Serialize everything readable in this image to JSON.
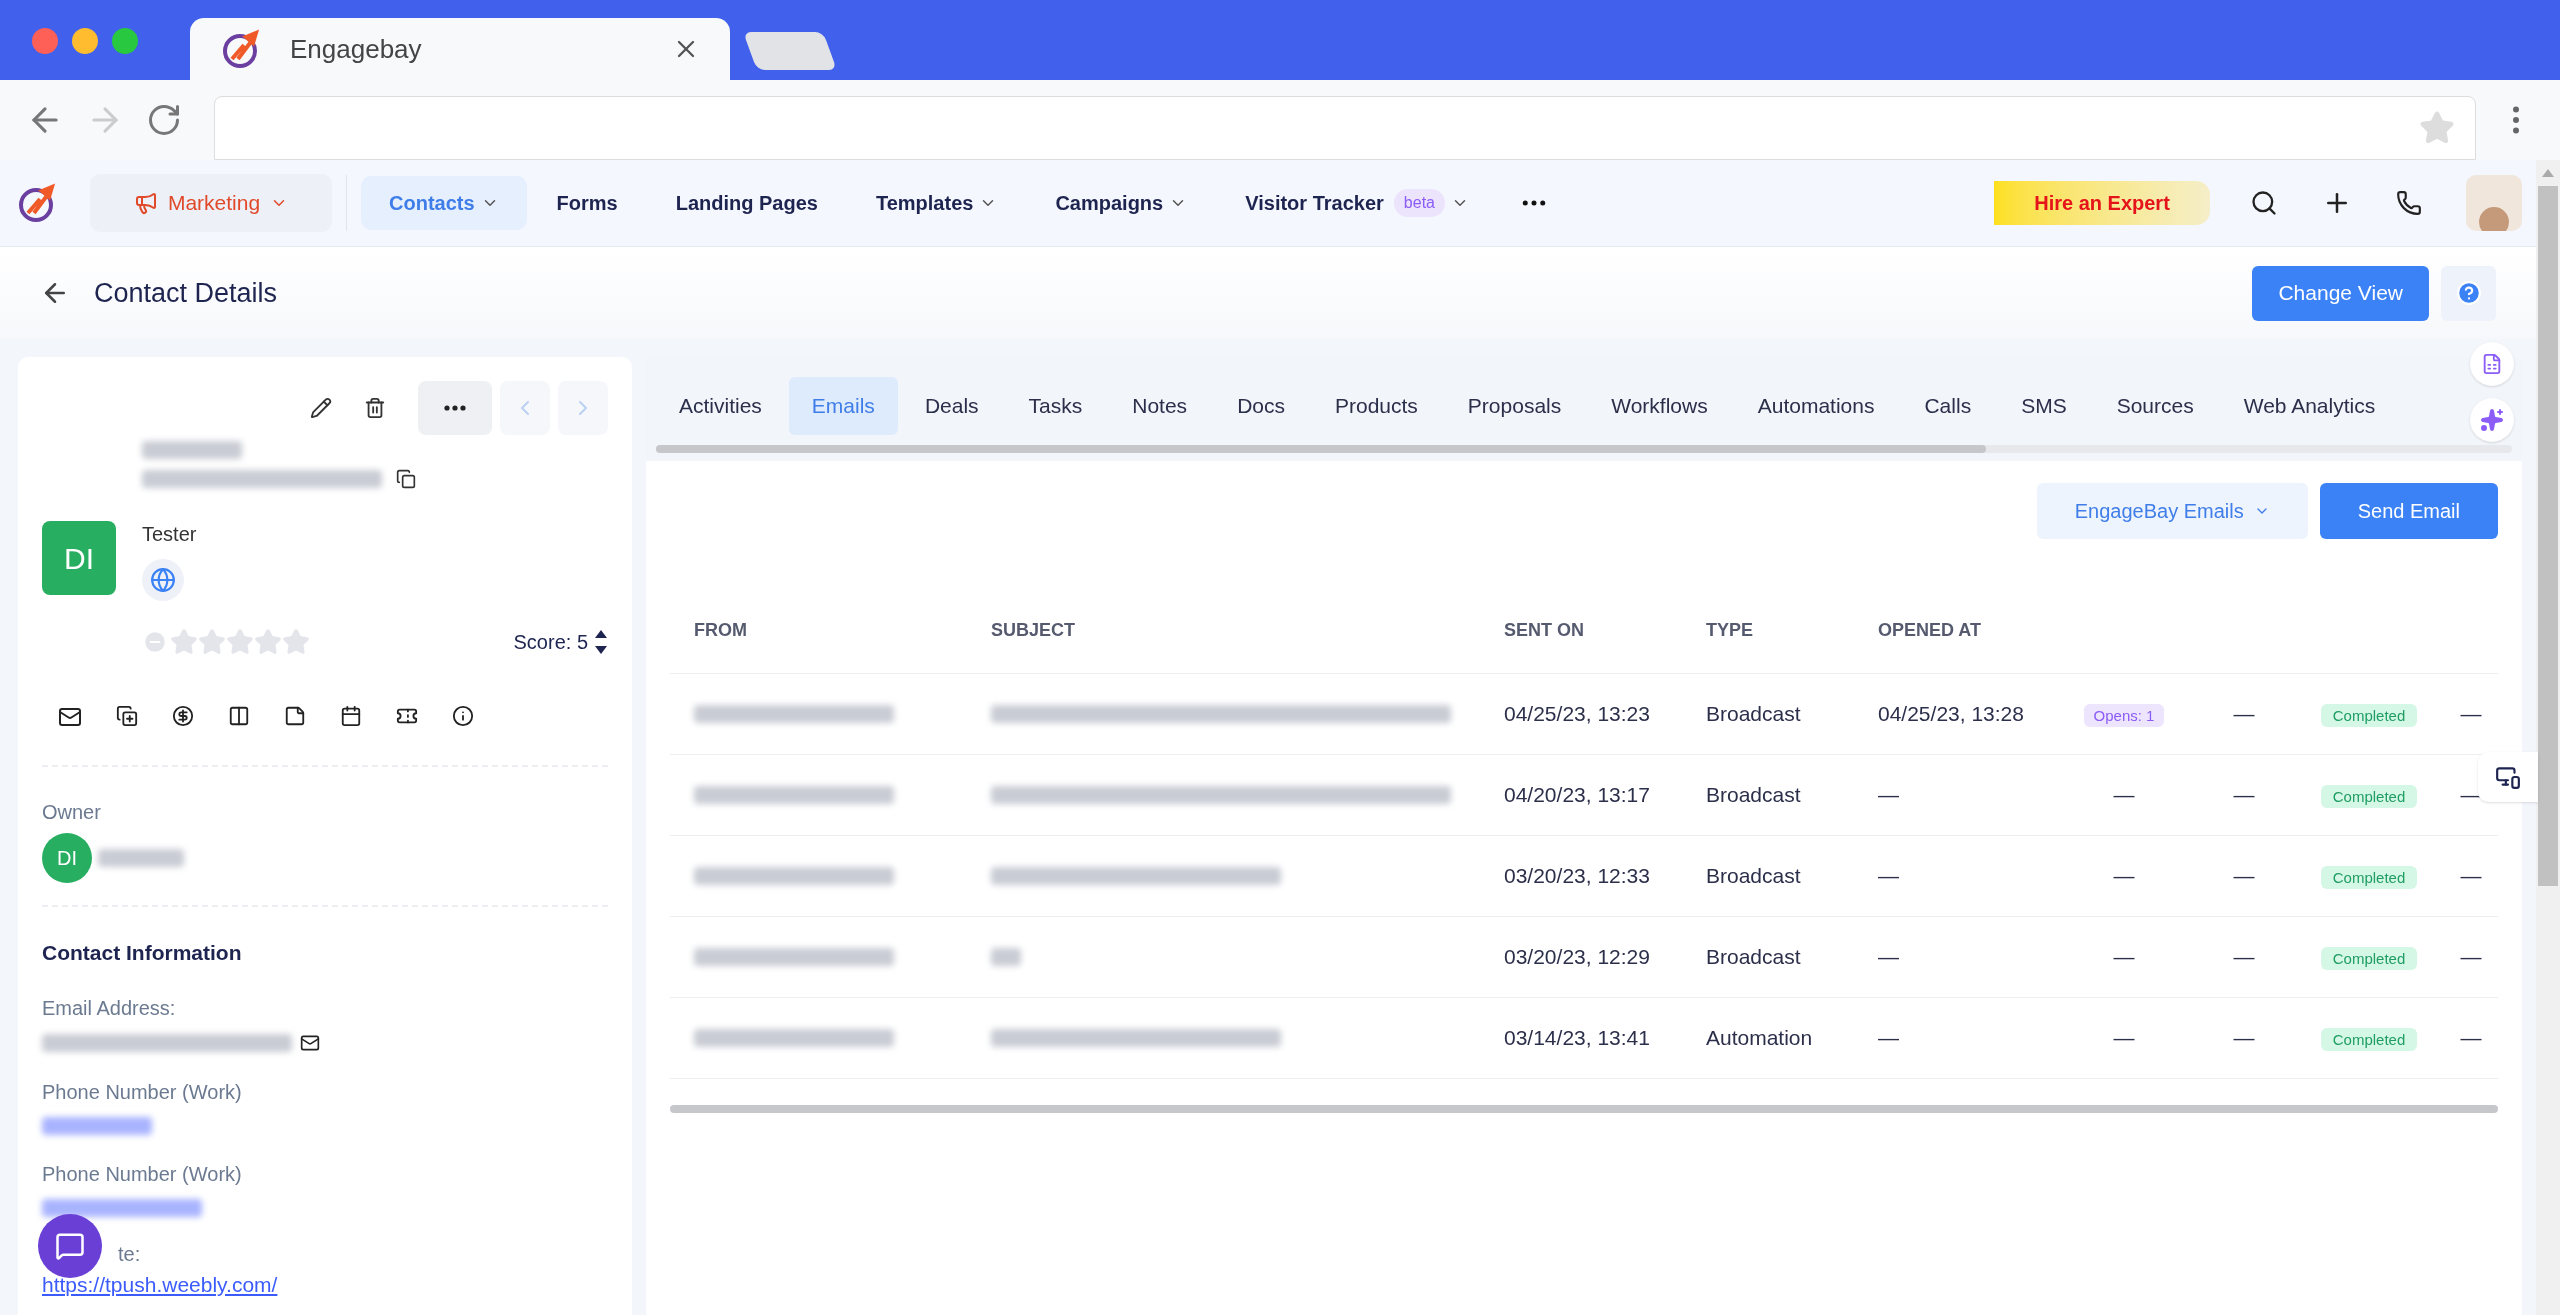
{
  "browser": {
    "tab_title": "Engagebay"
  },
  "nav": {
    "module": "Marketing",
    "items": [
      {
        "label": "Contacts",
        "selected": true,
        "dropdown": true
      },
      {
        "label": "Forms",
        "selected": false,
        "dropdown": false
      },
      {
        "label": "Landing Pages",
        "selected": false,
        "dropdown": false
      },
      {
        "label": "Templates",
        "selected": false,
        "dropdown": true
      },
      {
        "label": "Campaigns",
        "selected": false,
        "dropdown": true
      },
      {
        "label": "Visitor Tracker",
        "selected": false,
        "dropdown": true,
        "badge": "beta"
      }
    ],
    "hire": "Hire an Expert"
  },
  "header": {
    "title": "Contact Details",
    "button": "Change View"
  },
  "contact": {
    "initials": "DI",
    "role": "Tester",
    "stars": 0,
    "score": "Score: 5",
    "owner_label": "Owner",
    "owner_initials": "DI",
    "section_title": "Contact Information",
    "fields": [
      {
        "label": "Email Address:",
        "kind": "email"
      },
      {
        "label": "Phone Number (Work)",
        "kind": "phone"
      },
      {
        "label": "Phone Number (Work)",
        "kind": "phone"
      }
    ],
    "website": {
      "label": "te:",
      "value": "https://tpush.weebly.com/"
    }
  },
  "tabs": [
    {
      "label": "Activities",
      "selected": false
    },
    {
      "label": "Emails",
      "selected": true
    },
    {
      "label": "Deals",
      "selected": false
    },
    {
      "label": "Tasks",
      "selected": false
    },
    {
      "label": "Notes",
      "selected": false
    },
    {
      "label": "Docs",
      "selected": false
    },
    {
      "label": "Products",
      "selected": false
    },
    {
      "label": "Proposals",
      "selected": false
    },
    {
      "label": "Workflows",
      "selected": false
    },
    {
      "label": "Automations",
      "selected": false
    },
    {
      "label": "Calls",
      "selected": false
    },
    {
      "label": "SMS",
      "selected": false
    },
    {
      "label": "Sources",
      "selected": false
    },
    {
      "label": "Web Analytics",
      "selected": false
    }
  ],
  "email_source": "EngageBay Emails",
  "send_button": "Send Email",
  "table": {
    "columns": [
      "FROM",
      "SUBJECT",
      "SENT ON",
      "TYPE",
      "OPENED AT"
    ],
    "rows": [
      {
        "sent_on": "04/25/23, 13:23",
        "type": "Broadcast",
        "opened_at": "04/25/23, 13:28",
        "opens": "Opens: 1",
        "column_7": "—",
        "status": "Completed",
        "column_9": "—"
      },
      {
        "sent_on": "04/20/23, 13:17",
        "type": "Broadcast",
        "opened_at": "—",
        "opens": "—",
        "column_7": "—",
        "status": "Completed",
        "column_9": "—"
      },
      {
        "sent_on": "03/20/23, 12:33",
        "type": "Broadcast",
        "opened_at": "—",
        "opens": "—",
        "column_7": "—",
        "status": "Completed",
        "column_9": "—"
      },
      {
        "sent_on": "03/20/23, 12:29",
        "type": "Broadcast",
        "opened_at": "—",
        "opens": "—",
        "column_7": "—",
        "status": "Completed",
        "column_9": "—"
      },
      {
        "sent_on": "03/14/23, 13:41",
        "type": "Automation",
        "opened_at": "—",
        "opens": "—",
        "column_7": "—",
        "status": "Completed",
        "column_9": "—"
      }
    ]
  }
}
